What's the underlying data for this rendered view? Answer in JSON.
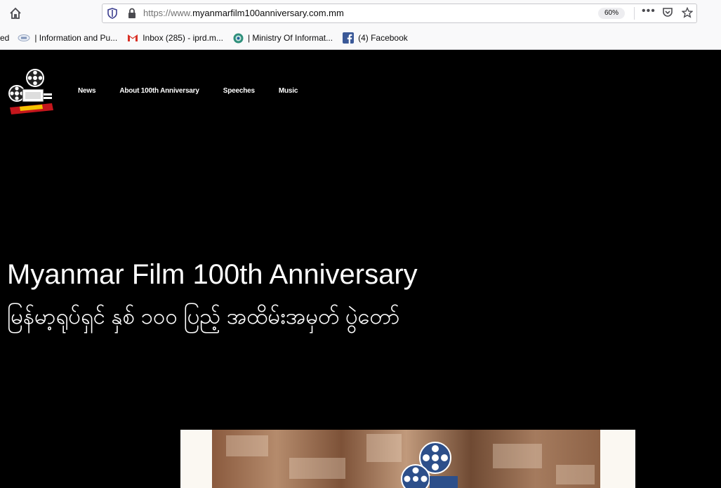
{
  "browser": {
    "url_prefix": "https://www.",
    "url_domain": "myanmarfilm100anniversary.com.mm",
    "zoom": "60%",
    "bookmarks": [
      {
        "label": "ed",
        "icon": "none"
      },
      {
        "label": "| Information and Pu...",
        "icon": "site-icon"
      },
      {
        "label": "Inbox (285) - iprd.m...",
        "icon": "gmail-icon"
      },
      {
        "label": "| Ministry Of Informat...",
        "icon": "globe-icon"
      },
      {
        "label": "(4) Facebook",
        "icon": "facebook-icon"
      }
    ]
  },
  "site": {
    "nav": [
      "News",
      "About 100th Anniversary",
      "Speeches",
      "Music"
    ],
    "hero_title": "Myanmar Film 100th Anniversary",
    "hero_subtitle": "မြန်မာ့ရုပ်ရှင် နှစ် ၁၀၀ ပြည့် အထိမ်းအမှတ် ပွဲတော်"
  },
  "colors": {
    "page_bg": "#000000",
    "text": "#ffffff",
    "facebook": "#3b5998",
    "gmail": "#d93025"
  }
}
